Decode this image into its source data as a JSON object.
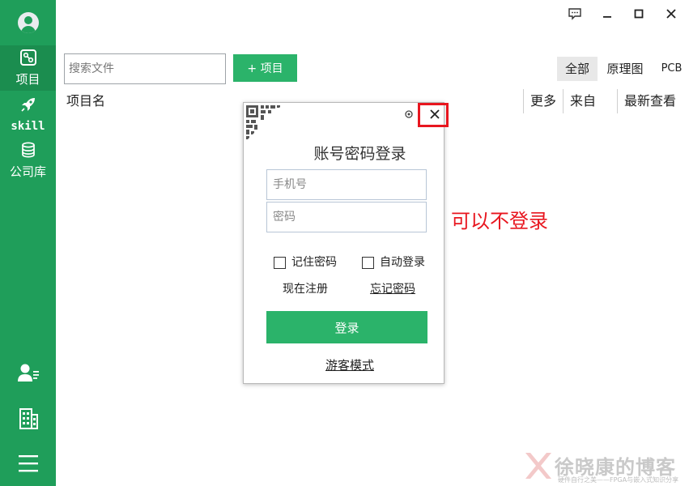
{
  "colors": {
    "sidebar": "#1f9e5a",
    "accent": "#2bb36a",
    "annotation": "#e8161f"
  },
  "sidebar": {
    "items": [
      {
        "label": "项目",
        "icon": "project-icon",
        "active": true
      },
      {
        "label": "skill",
        "icon": "rocket-icon",
        "active": false
      },
      {
        "label": "公司库",
        "icon": "database-icon",
        "active": false
      }
    ],
    "bottom_icons": [
      "user-list-icon",
      "building-icon",
      "menu-icon"
    ]
  },
  "window_controls": [
    "feedback-icon",
    "minimize-icon",
    "maximize-icon",
    "close-icon"
  ],
  "toolbar": {
    "search_placeholder": "搜索文件",
    "add_label": "+ 项目",
    "filters": [
      "全部",
      "原理图",
      "PCB"
    ],
    "active_filter": "全部"
  },
  "table": {
    "columns": [
      "项目名",
      "更多",
      "来自",
      "最新查看"
    ]
  },
  "login_dialog": {
    "title": "账号密码登录",
    "phone_placeholder": "手机号",
    "password_placeholder": "密码",
    "remember_label": "记住密码",
    "auto_login_label": "自动登录",
    "register_label": "现在注册",
    "forgot_label": "忘记密码",
    "login_button": "登录",
    "guest_mode": "游客模式"
  },
  "annotation": "可以不登录",
  "watermark": {
    "name": "徐晓康的博客",
    "tagline": "硬件自行之美——FPGA与嵌入式知识分享"
  }
}
